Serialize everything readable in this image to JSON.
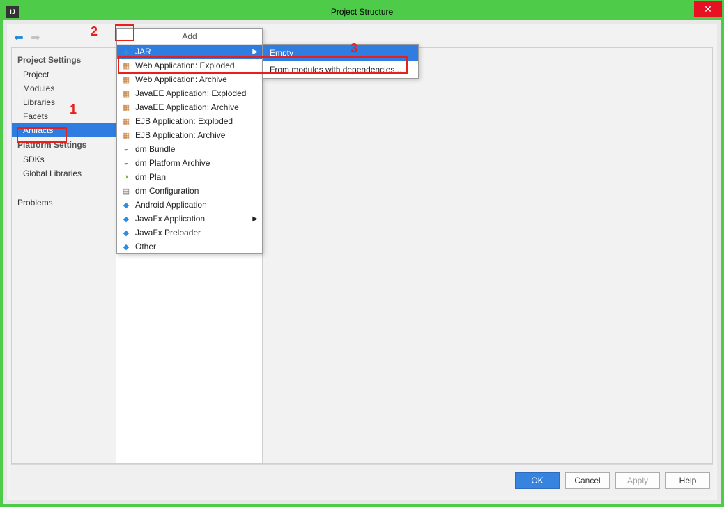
{
  "window": {
    "title": "Project Structure"
  },
  "annotations": {
    "one": "1",
    "two": "2",
    "three": "3"
  },
  "sidebar": {
    "section1": "Project Settings",
    "section2": "Platform Settings",
    "items1": [
      "Project",
      "Modules",
      "Libraries",
      "Facets",
      "Artifacts"
    ],
    "items2": [
      "SDKs",
      "Global Libraries"
    ],
    "problems": "Problems"
  },
  "add_menu": {
    "title": "Add",
    "items": [
      {
        "label": "JAR",
        "icon": "jar",
        "submenu": true,
        "selected": true
      },
      {
        "label": "Web Application: Exploded",
        "icon": "pkg"
      },
      {
        "label": "Web Application: Archive",
        "icon": "pkg"
      },
      {
        "label": "JavaEE Application: Exploded",
        "icon": "pkg"
      },
      {
        "label": "JavaEE Application: Archive",
        "icon": "pkg"
      },
      {
        "label": "EJB Application: Exploded",
        "icon": "pkg"
      },
      {
        "label": "EJB Application: Archive",
        "icon": "pkg"
      },
      {
        "label": "dm Bundle",
        "icon": "dm"
      },
      {
        "label": "dm Platform Archive",
        "icon": "dm"
      },
      {
        "label": "dm Plan",
        "icon": "plan"
      },
      {
        "label": "dm Configuration",
        "icon": "conf"
      },
      {
        "label": "Android Application",
        "icon": "diamond"
      },
      {
        "label": "JavaFx Application",
        "icon": "diamond",
        "submenu": true
      },
      {
        "label": "JavaFx Preloader",
        "icon": "diamond"
      },
      {
        "label": "Other",
        "icon": "diamond"
      }
    ]
  },
  "submenu": {
    "items": [
      {
        "label": "Empty",
        "selected": true
      },
      {
        "label": "From modules with dependencies..."
      }
    ]
  },
  "footer": {
    "ok": "OK",
    "cancel": "Cancel",
    "apply": "Apply",
    "help": "Help"
  }
}
